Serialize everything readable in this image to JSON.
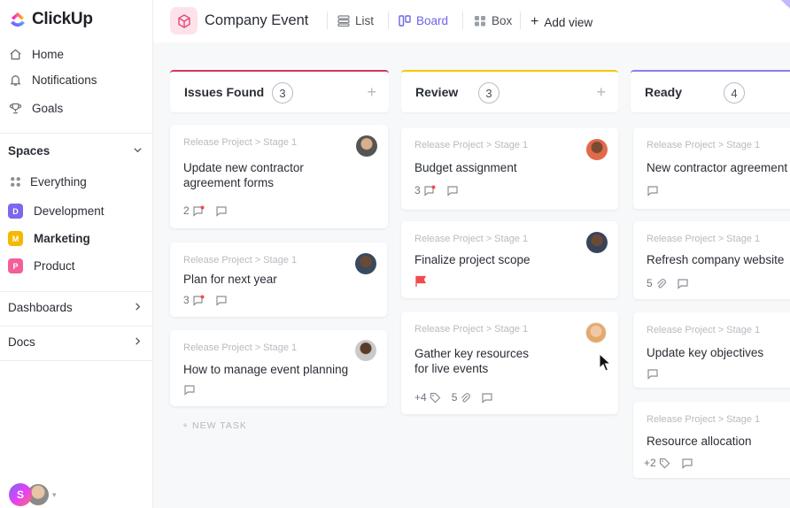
{
  "app": {
    "name": "ClickUp"
  },
  "sidebar": {
    "nav": [
      {
        "label": "Home",
        "icon": "home-icon"
      },
      {
        "label": "Notifications",
        "icon": "bell-icon"
      },
      {
        "label": "Goals",
        "icon": "trophy-icon"
      }
    ],
    "spaces_label": "Spaces",
    "everything_label": "Everything",
    "spaces": [
      {
        "letter": "D",
        "label": "Development",
        "color": "#7b68ee"
      },
      {
        "letter": "M",
        "label": "Marketing",
        "color": "#f5b800"
      },
      {
        "letter": "P",
        "label": "Product",
        "color": "#f35f9a"
      }
    ],
    "dashboards_label": "Dashboards",
    "docs_label": "Docs",
    "user_initial": "S"
  },
  "header": {
    "title": "Company Event",
    "views": {
      "list": "List",
      "board": "Board",
      "box": "Box",
      "add": "Add view"
    },
    "active_view": "Board"
  },
  "columns": [
    {
      "name": "Issues Found",
      "count": "3",
      "color": "#d3365d"
    },
    {
      "name": "Review",
      "count": "3",
      "color": "#f5c800"
    },
    {
      "name": "Ready",
      "count": "4",
      "color": "#8b80e8"
    }
  ],
  "crumb": "Release Project > Stage 1",
  "cards": {
    "c1": {
      "title_1": "Update new contractor",
      "title_2": "agreement forms",
      "comments": "2"
    },
    "c2": {
      "title": "Plan for next year",
      "comments": "3"
    },
    "c3": {
      "title": "How to manage event planning"
    },
    "c4": {
      "title": "Budget assignment",
      "comments": "3"
    },
    "c5": {
      "title": "Finalize project scope"
    },
    "c6": {
      "title_1": "Gather key resources",
      "title_2": "for live events",
      "tags": "+4",
      "attachments": "5"
    },
    "c7": {
      "title": "New contractor agreement"
    },
    "c8": {
      "title": "Refresh company website",
      "attachments": "5"
    },
    "c9": {
      "title": "Update key objectives"
    },
    "c10": {
      "title": "Resource allocation",
      "tags": "+2"
    }
  },
  "new_task_label": "+ NEW TASK",
  "colors": {
    "accent": "#7b68ee",
    "flag_red": "#f24b4b"
  }
}
